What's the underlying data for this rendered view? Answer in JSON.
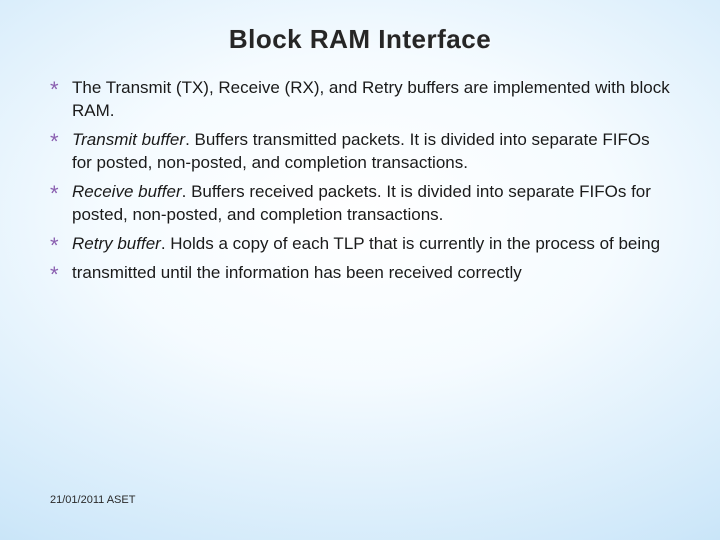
{
  "slide": {
    "title": "Block RAM Interface",
    "bullets": [
      {
        "lead": "",
        "text": "The Transmit (TX), Receive (RX), and Retry buffers are implemented with block RAM."
      },
      {
        "lead": "Transmit buffer",
        "text": ". Buffers transmitted packets. It is divided into separate FIFOs for posted, non-posted, and completion transactions."
      },
      {
        "lead": "Receive buffer",
        "text": ". Buffers received packets. It is divided into separate FIFOs for posted, non-posted, and completion transactions."
      },
      {
        "lead": "Retry buffer",
        "text": ". Holds a copy of each TLP that is currently in the process of being"
      },
      {
        "lead": "",
        "text": "transmitted until the information has been received correctly"
      }
    ],
    "footer": {
      "date": "21/01/2011",
      "org": "ASET"
    }
  },
  "glyphs": {
    "bullet_star": "*"
  }
}
